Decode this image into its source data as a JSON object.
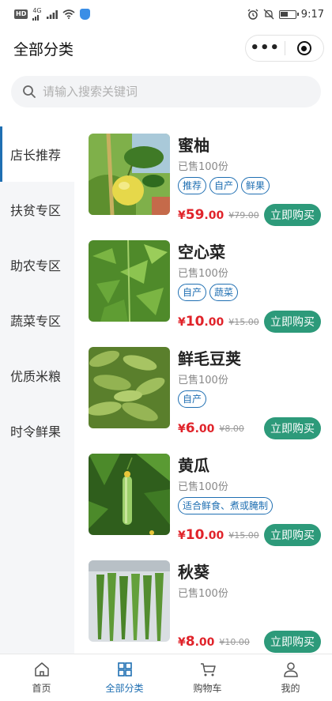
{
  "status_bar": {
    "time": "9:17",
    "hd": "HD",
    "network": "4G"
  },
  "nav": {
    "title": "全部分类"
  },
  "search": {
    "placeholder": "请输入搜索关键词"
  },
  "sidebar": {
    "active_index": 0,
    "items": [
      {
        "label": "店长推荐"
      },
      {
        "label": "扶贫专区"
      },
      {
        "label": "助农专区"
      },
      {
        "label": "蔬菜专区"
      },
      {
        "label": "优质米粮"
      },
      {
        "label": "时令鲜果"
      }
    ]
  },
  "products": [
    {
      "name": "蜜柚",
      "sold": "已售100份",
      "tags": [
        "推荐",
        "自产",
        "鲜果"
      ],
      "currency": "¥",
      "price": "59",
      "decimals": ".00",
      "original": "¥79.00",
      "buy_label": "立即购买",
      "image": "pomelo"
    },
    {
      "name": "空心菜",
      "sold": "已售100份",
      "tags": [
        "自产",
        "蔬菜"
      ],
      "currency": "¥",
      "price": "10",
      "decimals": ".00",
      "original": "¥15.00",
      "buy_label": "立即购买",
      "image": "water-spinach"
    },
    {
      "name": "鲜毛豆荚",
      "sold": "已售100份",
      "tags": [
        "自产"
      ],
      "currency": "¥",
      "price": "6",
      "decimals": ".00",
      "original": "¥8.00",
      "buy_label": "立即购买",
      "image": "edamame"
    },
    {
      "name": "黄瓜",
      "sold": "已售100份",
      "tags": [
        "适合鲜食、煮或腌制"
      ],
      "currency": "¥",
      "price": "10",
      "decimals": ".00",
      "original": "¥15.00",
      "buy_label": "立即购买",
      "image": "cucumber"
    },
    {
      "name": "秋葵",
      "sold": "已售100份",
      "tags": [],
      "currency": "¥",
      "price": "8",
      "decimals": ".00",
      "original": "¥10.00",
      "buy_label": "立即购买",
      "image": "okra"
    }
  ],
  "tabbar": {
    "active_index": 1,
    "items": [
      {
        "label": "首页",
        "icon": "home-icon"
      },
      {
        "label": "全部分类",
        "icon": "category-icon"
      },
      {
        "label": "购物车",
        "icon": "cart-icon"
      },
      {
        "label": "我的",
        "icon": "user-icon"
      }
    ]
  },
  "colors": {
    "accent": "#1f6fb2",
    "price": "#e0232a",
    "buy_button": "#2d9a7a"
  }
}
